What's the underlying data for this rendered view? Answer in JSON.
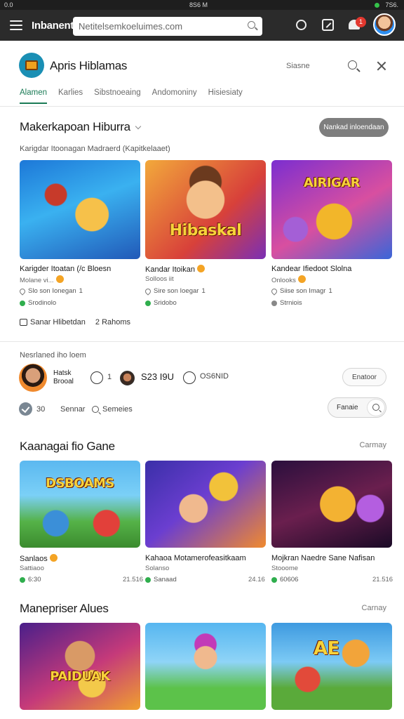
{
  "status_bar": {
    "left": "0.0",
    "clock": "8S6 M",
    "right": "7S6."
  },
  "app_bar": {
    "app_name": "Inbanent",
    "url": "Netitelsemkoeluimes.com",
    "notification_count": "1"
  },
  "header": {
    "site_title": "Apris Hiblamas",
    "share_label": "Siasne"
  },
  "tabs": [
    {
      "label": "Alamen",
      "active": true
    },
    {
      "label": "Karlies",
      "active": false
    },
    {
      "label": "Sibstnoeaing",
      "active": false
    },
    {
      "label": "Andomoniny",
      "active": false
    },
    {
      "label": "Hisiesiaty",
      "active": false
    }
  ],
  "featured": {
    "title": "Makerkapoan Hiburra",
    "subtitle": "Karigdar Itoonagan Madraerd (Kapitkelaaet)",
    "button_label": "Nankad inloendaan",
    "footer_label": "Sanar Hlibetdan",
    "footer_count": "2 Rahoms",
    "cards": [
      {
        "title": "Karigder Itoatan (/c Bloesn",
        "meta": "Molane vi...",
        "stat1": "Slo son Ionegan",
        "stat1_count": "1",
        "stat2": "Srodinolo",
        "thumb_text": ""
      },
      {
        "title": "Kandar Itoikan",
        "meta": "Solloos iit",
        "stat1": "Sire son Ioegar",
        "stat1_count": "1",
        "stat2": "Sridobo",
        "thumb_text": "Hibaskal"
      },
      {
        "title": "Kandear Ifiedoot Slolna",
        "meta": "Onlooks",
        "stat1": "Siise son Imagr",
        "stat1_count": "1",
        "stat2": "Strniois",
        "thumb_text": "AIRIGAR"
      }
    ]
  },
  "creator": {
    "section_label": "Nesrlaned iho loem",
    "name_line1": "Hatsk",
    "name_line2": "Brooal",
    "count_a": "1",
    "text_a": "S23 I9U",
    "text_b": "OS6NID",
    "follow_label": "Enatoor",
    "count_b": "30",
    "label_sennar": "Sennar",
    "label_search": "Semeies",
    "toggle_label": "Fanaie"
  },
  "section_games": {
    "title": "Kaanagai fio Gane",
    "more": "Carmay",
    "cards": [
      {
        "title": "Sanlaos",
        "meta": "Sattiaoo",
        "stat": "6:30",
        "right": "21.516",
        "thumb_text": "DSBOAMS"
      },
      {
        "title": "Kahaoa Motamerofeasitkaam",
        "meta": "Solanso",
        "stat": "Sanaad",
        "right": "24.16",
        "thumb_text": ""
      },
      {
        "title": "Mojkran Naedre Sane Nafisan",
        "meta": "Stooome",
        "stat": "60606",
        "right": "21.516",
        "thumb_text": ""
      }
    ]
  },
  "section_more": {
    "title": "Manepriser Alues",
    "more": "Carnay",
    "cards": [
      {
        "thumb_text": "PAIDUAK"
      },
      {
        "thumb_text": ""
      },
      {
        "thumb_text": "AE"
      }
    ]
  }
}
